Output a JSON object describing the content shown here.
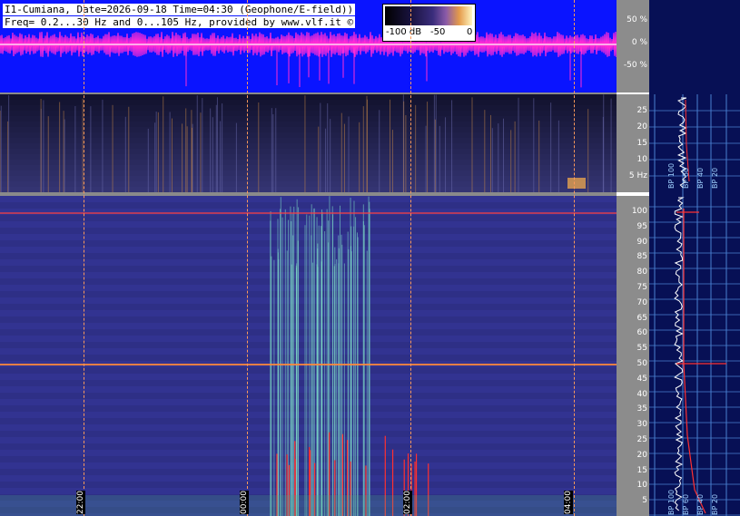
{
  "header": {
    "line1": "I1-Cumiana, Date=2026-09-18 Time=04:30 (Geophone/E-field))",
    "line2": "Freq= 0.2...30 Hz and 0...105 Hz, provided by www.vlf.it ©"
  },
  "colorbar": {
    "min_label": "-100 dB",
    "mid_label": "-50",
    "max_label": "0"
  },
  "amplitude_axis": {
    "ticks": [
      "50 %",
      "0 %",
      "-50 %"
    ]
  },
  "low_freq_axis": {
    "ticks": [
      "25",
      "20",
      "15",
      "10",
      "5 Hz"
    ]
  },
  "high_freq_axis": {
    "ticks": [
      "100",
      "95",
      "90",
      "85",
      "80",
      "75",
      "70",
      "65",
      "60",
      "55",
      "50",
      "45",
      "40",
      "35",
      "30",
      "25",
      "20",
      "15",
      "10",
      "5"
    ]
  },
  "time_labels": [
    "22:00",
    "00:00",
    "02:00",
    "04:00"
  ],
  "side_panel": {
    "bp_labels_top": [
      "BP 100",
      "BP 60",
      "BP 40",
      "BP 20"
    ],
    "bp_labels_bottom": [
      "BP 100",
      "BP 60",
      "BP 40",
      "BP 20"
    ]
  }
}
